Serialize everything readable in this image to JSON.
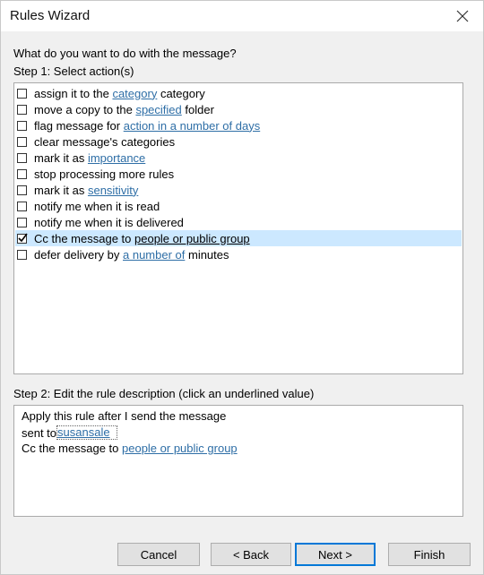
{
  "window": {
    "title": "Rules Wizard"
  },
  "prompt": "What do you want to do with the message?",
  "step1": {
    "label": "Step 1: Select action(s)",
    "items": [
      {
        "checked": false,
        "parts": [
          {
            "text": "assign it to the "
          },
          {
            "text": "category",
            "link": true
          },
          {
            "text": " category"
          }
        ]
      },
      {
        "checked": false,
        "parts": [
          {
            "text": "move a copy to the "
          },
          {
            "text": "specified",
            "link": true
          },
          {
            "text": " folder"
          }
        ]
      },
      {
        "checked": false,
        "parts": [
          {
            "text": "flag message for "
          },
          {
            "text": "action in a number of days",
            "link": true
          }
        ]
      },
      {
        "checked": false,
        "parts": [
          {
            "text": "clear message's categories"
          }
        ]
      },
      {
        "checked": false,
        "parts": [
          {
            "text": "mark it as "
          },
          {
            "text": "importance",
            "link": true
          }
        ]
      },
      {
        "checked": false,
        "parts": [
          {
            "text": "stop processing more rules"
          }
        ]
      },
      {
        "checked": false,
        "parts": [
          {
            "text": "mark it as "
          },
          {
            "text": "sensitivity",
            "link": true
          }
        ]
      },
      {
        "checked": false,
        "parts": [
          {
            "text": "notify me when it is read"
          }
        ]
      },
      {
        "checked": false,
        "parts": [
          {
            "text": "notify me when it is delivered"
          }
        ]
      },
      {
        "checked": true,
        "parts": [
          {
            "text": "Cc the message to "
          },
          {
            "text": "people or public group",
            "link": true
          }
        ]
      },
      {
        "checked": false,
        "parts": [
          {
            "text": "defer delivery by "
          },
          {
            "text": "a number of",
            "link": true
          },
          {
            "text": " minutes"
          }
        ]
      }
    ]
  },
  "step2": {
    "label": "Step 2: Edit the rule description (click an underlined value)",
    "line1": "Apply this rule after I send the message",
    "line2_prefix": "sent to",
    "line2_link": "susansale",
    "line3_prefix": "Cc the message to ",
    "line3_link": "people or public group"
  },
  "buttons": {
    "cancel": "Cancel",
    "back": "< Back",
    "next": "Next >",
    "finish": "Finish"
  }
}
